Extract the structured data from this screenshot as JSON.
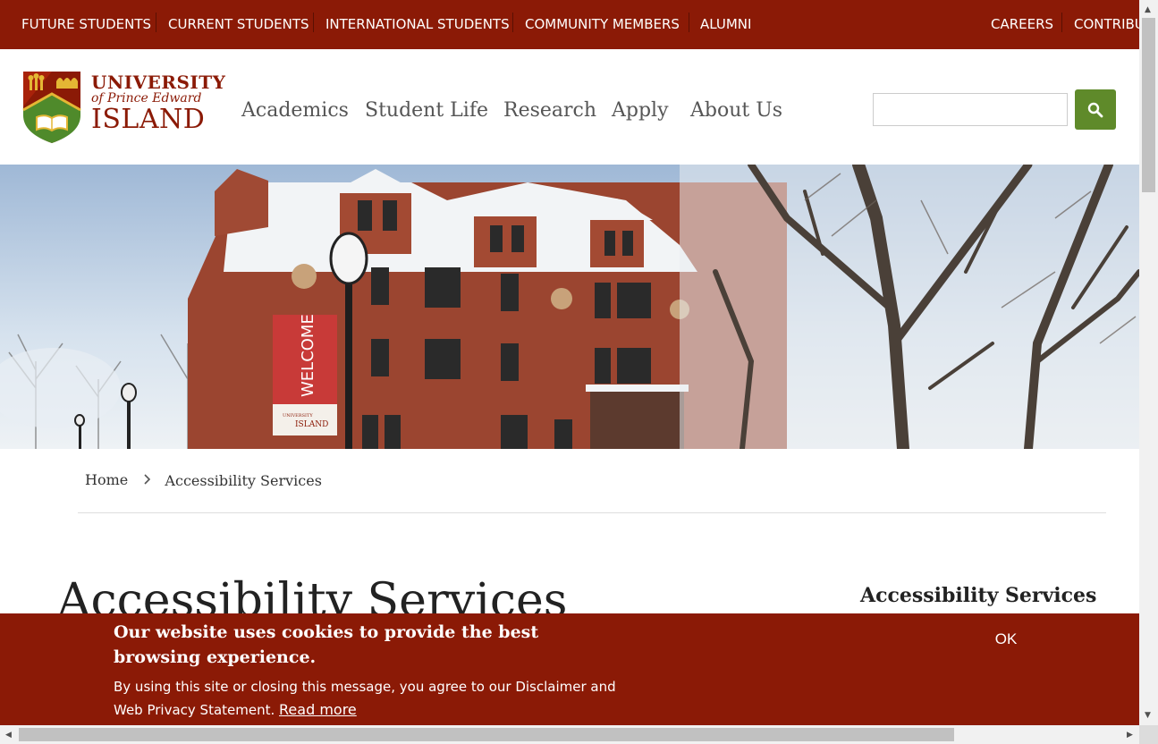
{
  "topbar": {
    "links": [
      "FUTURE STUDENTS",
      "CURRENT STUDENTS",
      "INTERNATIONAL STUDENTS",
      "COMMUNITY MEMBERS",
      "ALUMNI"
    ],
    "right_links": [
      "CAREERS",
      "CONTRIBU"
    ]
  },
  "logo": {
    "line1": "UNIVERSITY",
    "line2": "of Prince Edward",
    "line3": "ISLAND"
  },
  "mainnav": [
    "Academics",
    "Student Life",
    "Research",
    "Apply",
    "About Us"
  ],
  "search": {
    "placeholder": "",
    "value": "",
    "icon": "search-icon"
  },
  "hero": {
    "banner_text": "WELCOME",
    "banner_logo_line1": "UNIVERSITY",
    "banner_logo_line2": "ISLAND"
  },
  "breadcrumb": {
    "home": "Home",
    "current": "Accessibility Services"
  },
  "page": {
    "title": "Accessibility Services",
    "sidebar_title": "Accessibility Services"
  },
  "cookie": {
    "heading": "Our website uses cookies to provide the best browsing experience.",
    "body": "By using this site or closing this message, you agree to our Disclaimer and Web Privacy Statement.",
    "read_more": "Read more",
    "ok": "OK"
  },
  "colors": {
    "brand_red": "#8b1a06",
    "search_green": "#5f8a2a",
    "logo_green": "#4f8a2b",
    "logo_gold": "#e4b734"
  }
}
